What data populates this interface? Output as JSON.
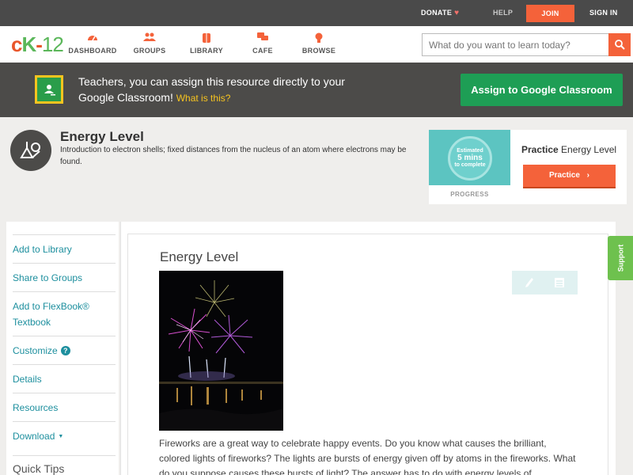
{
  "topbar": {
    "donate": "DONATE",
    "help": "HELP",
    "join": "JOIN",
    "signin": "SIGN IN"
  },
  "logo": {
    "part1": "c",
    "part2": "K",
    "part3": "-",
    "part4": "12"
  },
  "nav": {
    "items": [
      {
        "label": "DASHBOARD",
        "icon": "gauge-icon"
      },
      {
        "label": "GROUPS",
        "icon": "people-icon"
      },
      {
        "label": "LIBRARY",
        "icon": "book-icon"
      },
      {
        "label": "CAFE",
        "icon": "chat-icon"
      },
      {
        "label": "BROWSE",
        "icon": "lightbulb-icon"
      }
    ],
    "search_placeholder": "What do you want to learn today?"
  },
  "banner": {
    "text": "Teachers, you can assign this resource directly to your Google Classroom!",
    "link": "What is this?",
    "button": "Assign to Google Classroom"
  },
  "concept": {
    "title": "Energy Level",
    "description": "Introduction to electron shells; fixed distances from the nucleus of an atom where electrons may be found."
  },
  "practice": {
    "estimate_line1": "Estimated",
    "estimate_line2": "5 mins",
    "estimate_line3": "to complete",
    "progress_label": "PROGRESS",
    "heading_bold": "Practice",
    "heading_rest": "Energy Level",
    "button": "Practice"
  },
  "sidebar": {
    "items": [
      "Add to Library",
      "Share to Groups",
      "Add to FlexBook®",
      "Textbook",
      "Customize",
      "Details",
      "Resources",
      "Download"
    ],
    "quick_tips": "Quick Tips"
  },
  "lesson": {
    "title": "Energy Level",
    "text": "Fireworks are a great way to celebrate happy events. Do you know what causes the brilliant, colored lights of fireworks? The lights are bursts of energy given off by atoms in the fireworks. What do you suppose causes these bursts of light? The answer has to do with energy levels of"
  },
  "support": "Support",
  "colors": {
    "accent": "#f4623a",
    "link": "#1d8f9e",
    "green": "#1e9e55",
    "support": "#6ec14e"
  }
}
